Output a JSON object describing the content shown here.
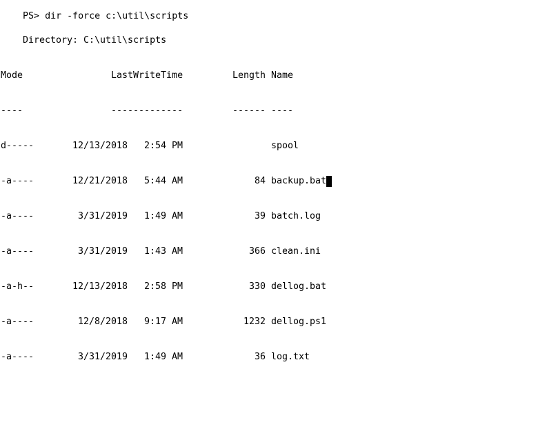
{
  "command": {
    "prompt": "PS>",
    "text": "dir -force c:\\util\\scripts"
  },
  "directory": {
    "label": "Directory:",
    "path": "C:\\util\\scripts"
  },
  "headers": {
    "mode": "Mode",
    "lastwritetime": "LastWriteTime",
    "length": "Length",
    "name": "Name"
  },
  "separators": {
    "mode": "----",
    "lastwritetime": "-------------",
    "length": "------",
    "name": "----"
  },
  "rows": [
    {
      "mode": "d-----",
      "date": "12/13/2018",
      "time": "2:54 PM",
      "length": "",
      "name": "spool"
    },
    {
      "mode": "-a----",
      "date": "12/21/2018",
      "time": "5:44 AM",
      "length": "84",
      "name": "backup.bat"
    },
    {
      "mode": "-a----",
      "date": "3/31/2019",
      "time": "1:49 AM",
      "length": "39",
      "name": "batch.log"
    },
    {
      "mode": "-a----",
      "date": "3/31/2019",
      "time": "1:43 AM",
      "length": "366",
      "name": "clean.ini"
    },
    {
      "mode": "-a-h--",
      "date": "12/13/2018",
      "time": "2:58 PM",
      "length": "330",
      "name": "dellog.bat"
    },
    {
      "mode": "-a----",
      "date": "12/8/2018",
      "time": "9:17 AM",
      "length": "1232",
      "name": "dellog.ps1"
    },
    {
      "mode": "-a----",
      "date": "3/31/2019",
      "time": "1:49 AM",
      "length": "36",
      "name": "log.txt"
    }
  ]
}
